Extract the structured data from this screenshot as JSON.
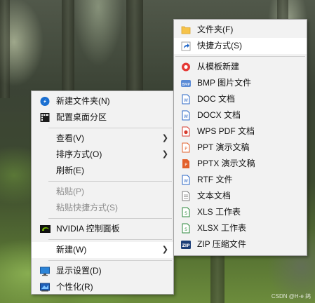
{
  "context_menu": {
    "items": [
      {
        "label": "新建文件夹(N)"
      },
      {
        "label": "配置桌面分区"
      },
      {
        "label": "查看(V)"
      },
      {
        "label": "排序方式(O)"
      },
      {
        "label": "刷新(E)"
      },
      {
        "label": "粘贴(P)"
      },
      {
        "label": "粘贴快捷方式(S)"
      },
      {
        "label": "NVIDIA 控制面板"
      },
      {
        "label": "新建(W)"
      },
      {
        "label": "显示设置(D)"
      },
      {
        "label": "个性化(R)"
      }
    ]
  },
  "new_submenu": {
    "items": [
      {
        "label": "文件夹(F)"
      },
      {
        "label": "快捷方式(S)"
      },
      {
        "label": "从模板新建"
      },
      {
        "label": "BMP 图片文件"
      },
      {
        "label": "DOC 文档"
      },
      {
        "label": "DOCX 文档"
      },
      {
        "label": "WPS PDF 文档"
      },
      {
        "label": "PPT 演示文稿"
      },
      {
        "label": "PPTX 演示文稿"
      },
      {
        "label": "RTF 文件"
      },
      {
        "label": "文本文档"
      },
      {
        "label": "XLS 工作表"
      },
      {
        "label": "XLSX 工作表"
      },
      {
        "label": "ZIP 压缩文件"
      }
    ]
  },
  "watermark": "CSDN @H-e 鸽",
  "colors": {
    "menu_bg": "#f2f2f2",
    "highlight_bg": "#ffffff",
    "disabled_text": "#8b8b8b",
    "word_blue": "#2b67c6",
    "wps_red": "#d63b2f",
    "ppt_orange": "#e2602b",
    "excel_green": "#2e8a3e"
  }
}
